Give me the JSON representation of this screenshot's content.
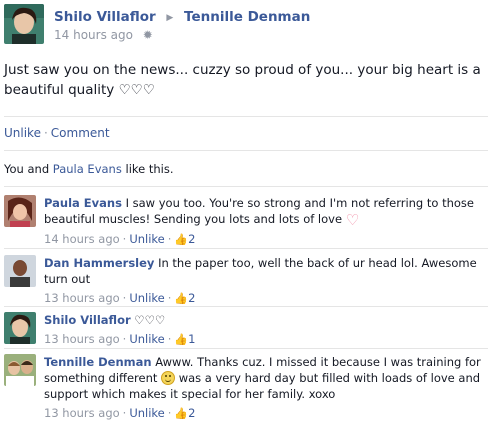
{
  "post": {
    "author": "Shilo Villaflor",
    "target": "Tennille Denman",
    "timestamp": "14 hours ago",
    "text": "Just saw you on the news... cuzzy so proud of you... your big heart is a beautiful quality ♡♡♡",
    "actions": {
      "unlike": "Unlike",
      "comment": "Comment"
    },
    "likes": {
      "prefix": "You and ",
      "name": "Paula Evans",
      "suffix": " like this."
    }
  },
  "comments": [
    {
      "author": "Paula Evans",
      "text": "I saw you too. You're so strong and I'm not referring to those beautiful muscles! Sending you lots and lots of love",
      "timestamp": "14 hours ago",
      "unlike": "Unlike",
      "likes": "2"
    },
    {
      "author": "Dan Hammersley",
      "text": "In the paper too, well the back of ur head lol. Awesome turn out",
      "timestamp": "13 hours ago",
      "unlike": "Unlike",
      "likes": "2"
    },
    {
      "author": "Shilo Villaflor",
      "text": "♡♡♡",
      "timestamp": "13 hours ago",
      "unlike": "Unlike",
      "likes": "1"
    },
    {
      "author": "Tennille Denman",
      "text_before": "Awww. Thanks cuz. I missed it because I was training for something different",
      "text_after": "was a very hard day but filled with loads of love and support which makes it special for her family. xoxo",
      "timestamp": "13 hours ago",
      "unlike": "Unlike",
      "likes": "2"
    }
  ],
  "colors": {
    "link": "#3b5998",
    "muted": "#9197a3",
    "divider": "#e5e5e5",
    "text": "#141823"
  },
  "icons": {
    "separator": "triangle-right-icon",
    "settings": "gear-icon",
    "like": "thumbs-up-icon",
    "emoticon_heart": "heart-icon",
    "emoticon_smile": "smiley-icon"
  }
}
